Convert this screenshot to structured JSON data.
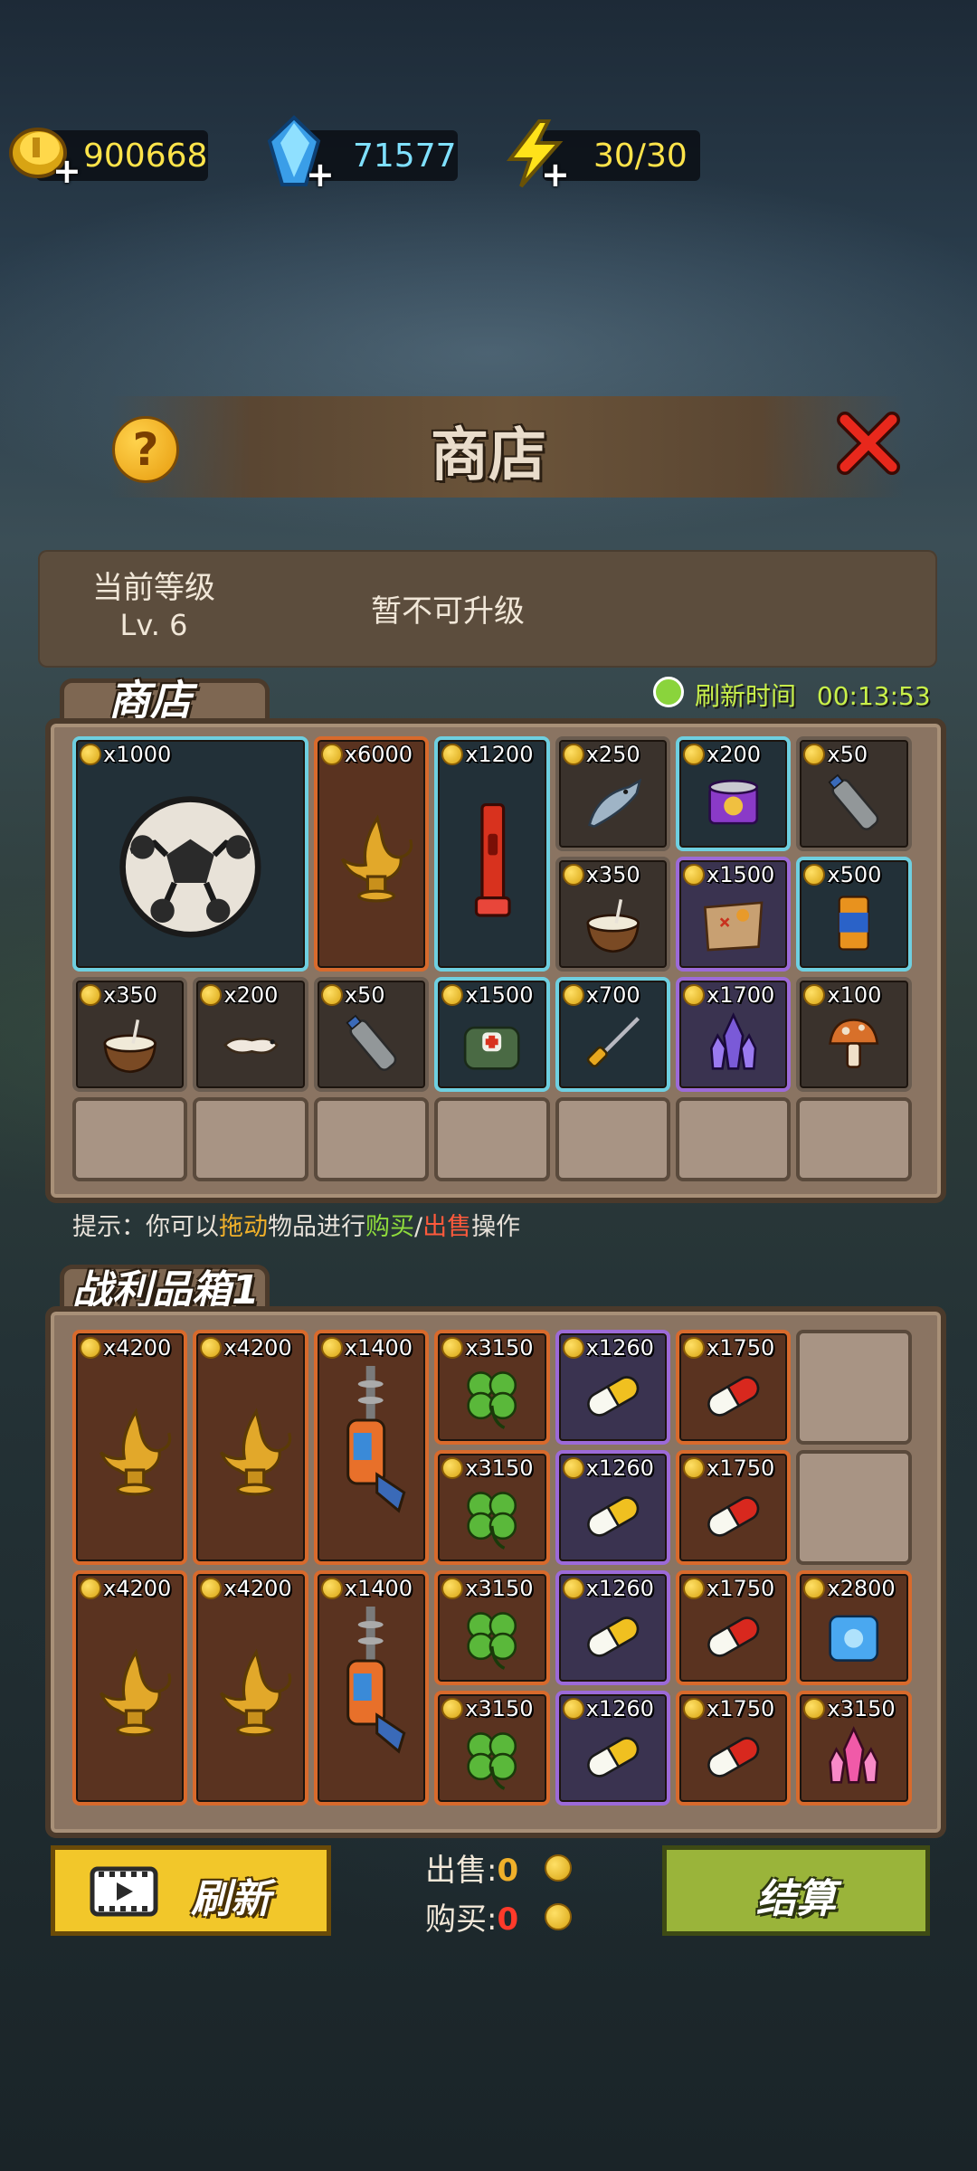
{
  "currency": {
    "gold": "900668",
    "gems": "71577",
    "energy": "30/30"
  },
  "title": "商店",
  "level": {
    "label": "当前等级",
    "value": "Lv. 6",
    "message": "暂不可升级"
  },
  "shop": {
    "tab_label": "商店",
    "refresh_label": "刷新时间",
    "refresh_time": "00:13:53",
    "items": [
      {
        "price": "x1000",
        "name": "soccer-ball",
        "rarity": "cyan"
      },
      {
        "price": "x6000",
        "name": "magic-lamp",
        "rarity": "orange"
      },
      {
        "price": "x1200",
        "name": "flashlight",
        "rarity": "cyan"
      },
      {
        "price": "x250",
        "name": "fish",
        "rarity": "grey"
      },
      {
        "price": "x200",
        "name": "canned-food",
        "rarity": "cyan"
      },
      {
        "price": "x50",
        "name": "water-bottle",
        "rarity": "grey"
      },
      {
        "price": "x350",
        "name": "coconut",
        "rarity": "grey"
      },
      {
        "price": "x1500",
        "name": "treasure-map",
        "rarity": "purple"
      },
      {
        "price": "x500",
        "name": "canned-drink",
        "rarity": "cyan"
      },
      {
        "price": "x350",
        "name": "coconut",
        "rarity": "grey"
      },
      {
        "price": "x200",
        "name": "grub",
        "rarity": "grey"
      },
      {
        "price": "x50",
        "name": "water-bottle",
        "rarity": "grey"
      },
      {
        "price": "x1500",
        "name": "medical-backpack",
        "rarity": "cyan"
      },
      {
        "price": "x700",
        "name": "screwdriver",
        "rarity": "cyan"
      },
      {
        "price": "x1700",
        "name": "crystal",
        "rarity": "purple"
      },
      {
        "price": "x100",
        "name": "mushroom",
        "rarity": "grey"
      }
    ]
  },
  "hint": {
    "prefix": "提示：你可以",
    "drag": "拖动",
    "mid": "物品进行",
    "buy": "购买",
    "slash": "/",
    "sell": "出售",
    "suffix": "操作"
  },
  "loot": {
    "tab_label": "战利品箱1",
    "items": [
      {
        "price": "x4200",
        "name": "magic-lamp",
        "rarity": "orange"
      },
      {
        "price": "x4200",
        "name": "magic-lamp",
        "rarity": "orange"
      },
      {
        "price": "x1400",
        "name": "ray-gun",
        "rarity": "orange"
      },
      {
        "price": "x3150",
        "name": "clover",
        "rarity": "orange"
      },
      {
        "price": "x1260",
        "name": "pill-yellow",
        "rarity": "purple"
      },
      {
        "price": "x1750",
        "name": "pill-red",
        "rarity": "orange"
      },
      {
        "price": "x3150",
        "name": "clover",
        "rarity": "orange"
      },
      {
        "price": "x1260",
        "name": "pill-yellow",
        "rarity": "purple"
      },
      {
        "price": "x1750",
        "name": "pill-red",
        "rarity": "orange"
      },
      {
        "price": "x4200",
        "name": "magic-lamp",
        "rarity": "orange"
      },
      {
        "price": "x4200",
        "name": "magic-lamp",
        "rarity": "orange"
      },
      {
        "price": "x1400",
        "name": "ray-gun",
        "rarity": "orange"
      },
      {
        "price": "x3150",
        "name": "clover",
        "rarity": "orange"
      },
      {
        "price": "x1260",
        "name": "pill-yellow",
        "rarity": "purple"
      },
      {
        "price": "x1750",
        "name": "pill-red",
        "rarity": "orange"
      },
      {
        "price": "x2800",
        "name": "ice-cube",
        "rarity": "orange"
      },
      {
        "price": "x3150",
        "name": "clover",
        "rarity": "orange"
      },
      {
        "price": "x1260",
        "name": "pill-yellow",
        "rarity": "purple"
      },
      {
        "price": "x1750",
        "name": "pill-red",
        "rarity": "orange"
      },
      {
        "price": "x3150",
        "name": "pink-crystal",
        "rarity": "orange"
      }
    ]
  },
  "footer": {
    "refresh_button": "刷新",
    "sell_label": "出售:",
    "sell_value": "0",
    "buy_label": "购买:",
    "buy_value": "0",
    "settle_button": "结算"
  },
  "colors": {
    "cyan": "#6ecfe0",
    "orange": "#d86a2c",
    "purple": "#9c6ad8",
    "grey": "#6a5c50",
    "gold_text": "#ffe44a",
    "gem_text": "#7fe0ff"
  }
}
